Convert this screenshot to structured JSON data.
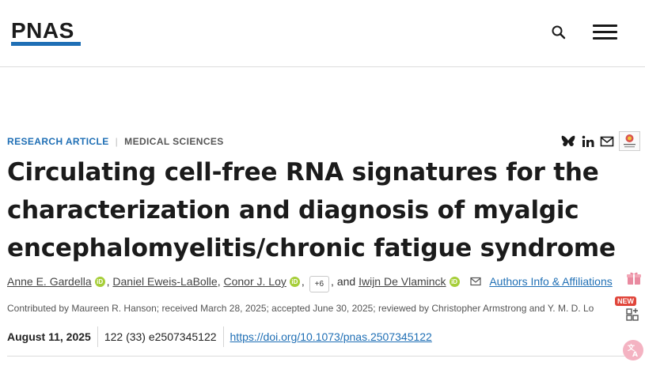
{
  "header": {
    "logo_text": "PNAS",
    "brand_color": "#1f6fb5"
  },
  "article": {
    "category_primary": "RESEARCH ARTICLE",
    "category_separator": "|",
    "category_secondary": "MEDICAL SCIENCES",
    "title": "Circulating cell-free RNA signatures for the characterization and diagnosis of myalgic encephalomyelitis/chronic fatigue syndrome",
    "authors": [
      {
        "name": "Anne E. Gardella",
        "orcid": true
      },
      {
        "name": "Daniel Eweis-LaBolle",
        "orcid": false
      },
      {
        "name": "Conor J. Loy",
        "orcid": true
      },
      {
        "name": "Iwijn De Vlaminck",
        "orcid": true
      }
    ],
    "more_authors": "+6",
    "and_text": ", and",
    "comma": ",",
    "affiliations_link": "Authors Info & Affiliations",
    "contributed_line": "Contributed by Maureen R. Hanson; received March 28, 2025; accepted June 30, 2025; reviewed by Christopher Armstrong and Y. M. D. Lo",
    "pub_date": "August 11, 2025",
    "citation": "122 (33) e2507345122",
    "doi": "https://doi.org/10.1073/pnas.2507345122"
  },
  "share_icons": [
    "bluesky-icon",
    "linkedin-icon",
    "email-icon"
  ],
  "badge_icon": "check-for-updates-icon",
  "floating": {
    "new_label": "NEW",
    "icons": [
      "gift-icon",
      "apps-icon",
      "translate-icon"
    ]
  }
}
